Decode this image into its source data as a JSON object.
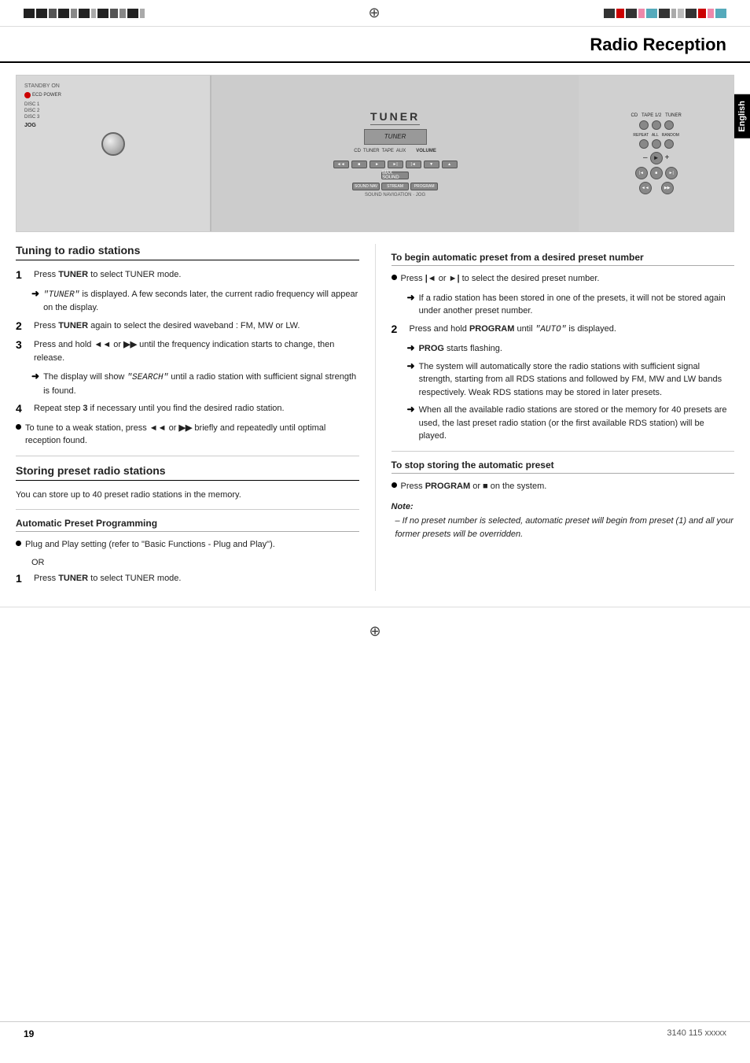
{
  "page": {
    "title": "Radio Reception",
    "page_number": "19",
    "catalog_number": "3140 115 xxxxx",
    "language_tab": "English"
  },
  "tuning_section": {
    "title": "Tuning to radio stations",
    "steps": [
      {
        "num": "1",
        "text": "Press TUNER to select TUNER mode.",
        "note": "\"TUNER\" is displayed.  A few seconds later, the current radio frequency will appear on the display."
      },
      {
        "num": "2",
        "text": "Press TUNER again to select the desired waveband : FM, MW or LW."
      },
      {
        "num": "3",
        "text": "Press and hold ◄◄ or ►► until the frequency indication starts to change, then release.",
        "note": "The display will show \"SEARCH\" until a radio station with sufficient signal strength is found."
      },
      {
        "num": "4",
        "text": "Repeat step 3 if necessary until you find the desired radio station."
      }
    ],
    "bullet": "To tune to a weak station, press ◄◄ or ►► briefly and repeatedly until optimal reception found."
  },
  "storing_section": {
    "title": "Storing preset radio stations",
    "intro": "You can store up to 40 preset radio stations in the memory.",
    "auto_preset": {
      "title": "Automatic Preset Programming",
      "bullets": [
        "Plug and Play setting (refer to \"Basic Functions - Plug and Play\").",
        "OR"
      ],
      "step1": "Press TUNER to select TUNER mode."
    }
  },
  "right_column": {
    "auto_preset_from": {
      "title": "To begin automatic preset from a desired preset number",
      "bullet1": "Press |◄ or ►| to select the desired preset number.",
      "arrow1": "If a radio station has been stored in one of the presets, it will not be stored again under another preset number.",
      "step2_text": "Press and hold PROGRAM until \"AUTO\" is displayed.",
      "arrow2": "PROG starts flashing.",
      "arrow3": "The system will automatically store the radio stations with sufficient signal strength, starting from all RDS stations and followed by FM, MW and LW bands respectively. Weak RDS stations may be stored in later presets.",
      "arrow4": "When all the available radio stations are stored or the memory for 40 presets are used, the last preset radio station (or the first available RDS station) will be played."
    },
    "stop_storing": {
      "title": "To stop storing the automatic preset",
      "text": "Press PROGRAM or ■ on the system."
    },
    "note": {
      "title": "Note:",
      "text": "– If no preset number is selected, automatic preset will begin from preset (1) and all your former presets will be overridden."
    }
  }
}
